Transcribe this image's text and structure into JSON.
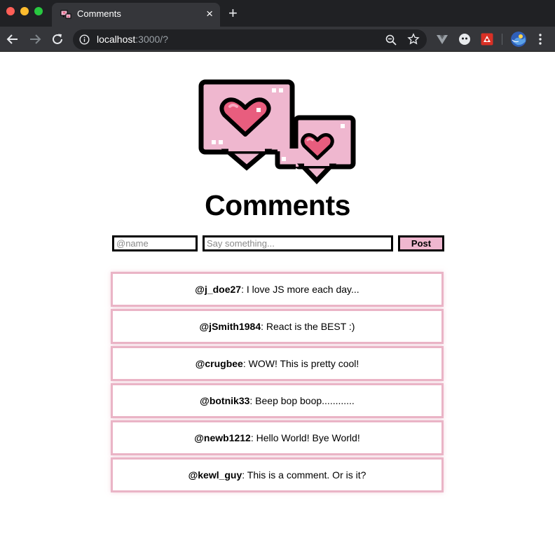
{
  "browser": {
    "tab_title": "Comments",
    "tab_close_glyph": "×",
    "new_tab_glyph": "+",
    "url_host": "localhost",
    "url_rest": ":3000/?"
  },
  "page": {
    "title": "Comments",
    "name_placeholder": "@name",
    "message_placeholder": "Say something...",
    "post_label": "Post"
  },
  "colors": {
    "accent_pink": "#efb7cf",
    "heart_red": "#e85d7e",
    "comment_border": "#eab4c6"
  },
  "comments": [
    {
      "author": "@j_doe27",
      "text": ": I love JS more each day..."
    },
    {
      "author": "@jSmith1984",
      "text": ": React is the BEST :)"
    },
    {
      "author": "@crugbee",
      "text": ": WOW! This is pretty cool!"
    },
    {
      "author": "@botnik33",
      "text": ": Beep bop boop............"
    },
    {
      "author": "@newb1212",
      "text": ": Hello World! Bye World!"
    },
    {
      "author": "@kewl_guy",
      "text": ": This is a comment. Or is it?"
    }
  ]
}
